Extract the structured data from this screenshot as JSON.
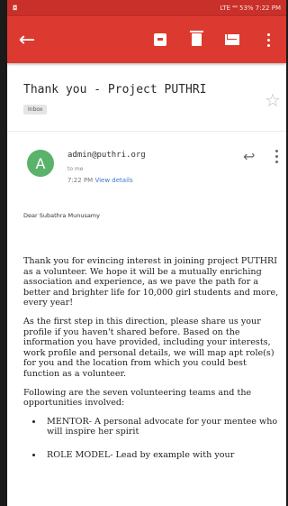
{
  "status_bar": {
    "left_icon": "notification-icon",
    "right_text": "LTE ⁴⁶ 53% 7:22 PM"
  },
  "app_bar": {
    "icons": [
      "back-arrow-icon",
      "archive-icon",
      "trash-icon",
      "mail-icon",
      "more-vert-icon"
    ]
  },
  "email": {
    "subject": "Thank you - Project PUTHRI",
    "label": "Inbox",
    "sender_initial": "A",
    "sender": "admin@puthri.org",
    "to": "to me",
    "time": "7:22 PM",
    "view_details": "View details",
    "greeting": "Dear Subathra Munusamy",
    "paragraphs": [
      "Thank you for evincing interest in joining project PUTHRI as a volunteer. We hope it will be a mutually enriching association and experience, as we pave the path for a better and brighter life for 10,000 girl students and more, every year!",
      "As the first step in this direction, please share us your profile if you haven't shared before. Based on the information you have provided, including your interests, work profile and personal details, we will map apt role(s) for you and the location from which you could best function as a volunteer.",
      "Following are the seven volunteering teams and the opportunities involved:"
    ],
    "list_items": [
      "MENTOR- A personal advocate for your mentee who will inspire her spirit",
      "ROLE MODEL- Lead by example with your"
    ]
  }
}
